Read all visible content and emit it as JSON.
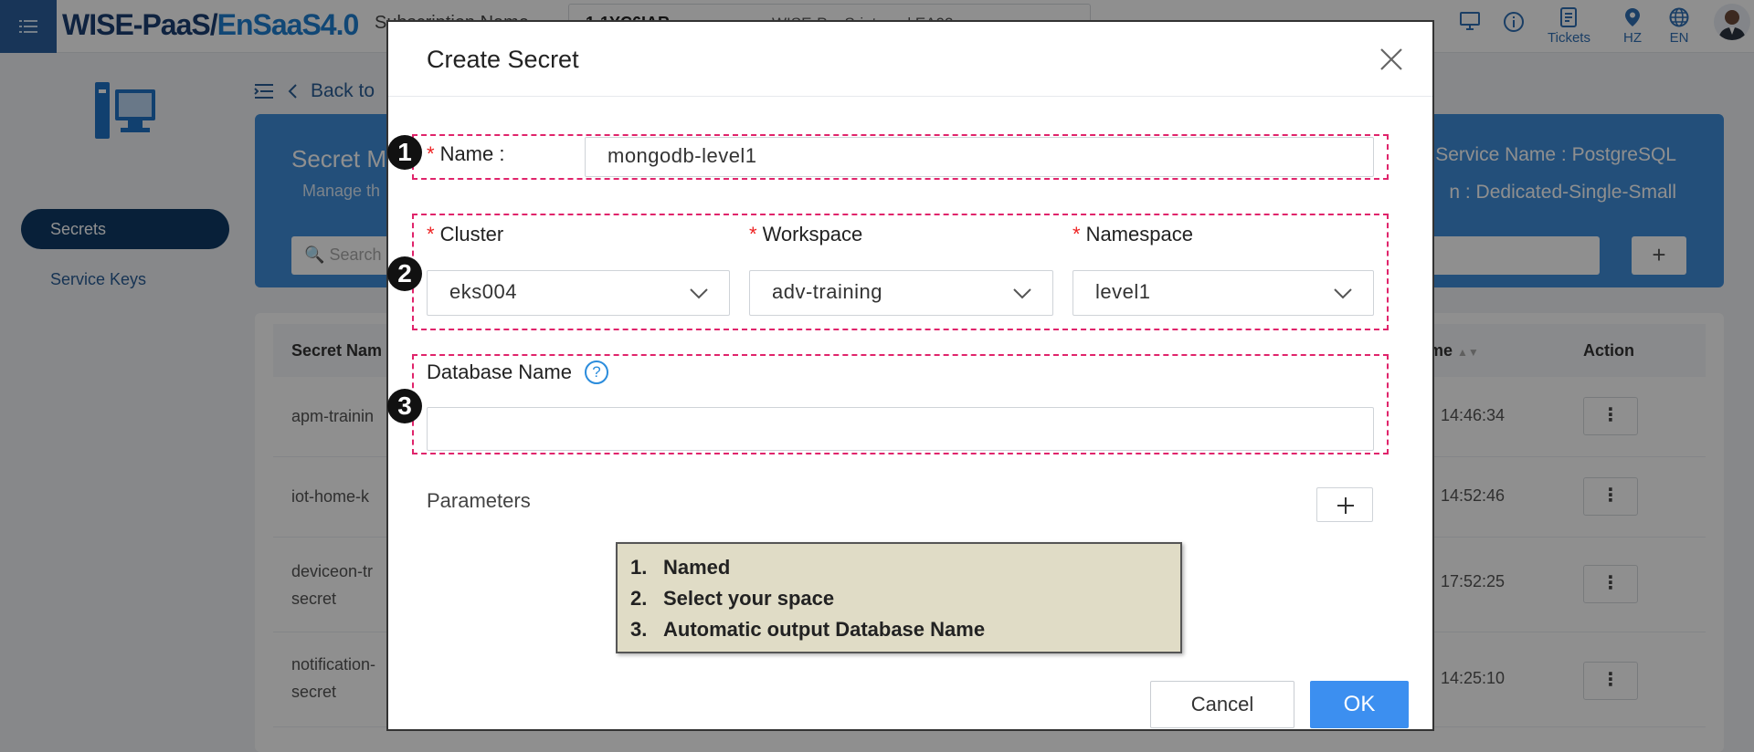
{
  "topbar": {
    "logo_part1": "WISE-PaaS/",
    "logo_part2": "EnSaaS4.0",
    "subscription_label": "Subscription Name",
    "subscription_value": "1-1YC6IAR",
    "subscription_detail": "WISE-PaaS-internal EA02",
    "icons": [
      "menu-icon",
      "monitor-icon",
      "info-icon",
      "tickets-icon",
      "location-icon",
      "globe-icon",
      "avatar"
    ],
    "tickets_label": "Tickets",
    "region_label": "HZ",
    "language_label": "EN"
  },
  "sidebar": {
    "items": [
      {
        "label": "Secrets",
        "active": true
      },
      {
        "label": "Service Keys",
        "active": false
      }
    ]
  },
  "breadcrumb": {
    "back_label": "Back to"
  },
  "banner": {
    "title": "Secret M",
    "description": "Manage th",
    "service_name": "Service Name : PostgreSQL",
    "plan": "n : Dedicated-Single-Small",
    "search_placeholder": "Search"
  },
  "table": {
    "headers": {
      "name": "Secret Nam",
      "time": "me",
      "action": "Action"
    },
    "rows": [
      {
        "name": "apm-trainin",
        "time": "14:46:34"
      },
      {
        "name": "iot-home-k",
        "time": "14:52:46"
      },
      {
        "name": "deviceon-tr\nsecret",
        "time": "17:52:25"
      },
      {
        "name": "notification-\nsecret",
        "time": "14:25:10"
      }
    ],
    "action_glyph": "⋮"
  },
  "modal": {
    "title": "Create Secret",
    "required_mark": "*",
    "name_label": "Name :",
    "name_value": "mongodb-level1",
    "cluster_label": "Cluster",
    "cluster_value": "eks004",
    "workspace_label": "Workspace",
    "workspace_value": "adv-training",
    "namespace_label": "Namespace",
    "namespace_value": "level1",
    "database_label": "Database Name",
    "database_value": "",
    "help_glyph": "?",
    "parameters_label": "Parameters",
    "cancel_label": "Cancel",
    "ok_label": "OK"
  },
  "annotations": {
    "badges": [
      "1",
      "2",
      "3"
    ],
    "note_numbers": [
      "1.",
      "2.",
      "3."
    ],
    "notes": [
      "Named",
      "Select your space",
      "Automatic output Database Name"
    ],
    "highlight_color": "#e0246b"
  }
}
